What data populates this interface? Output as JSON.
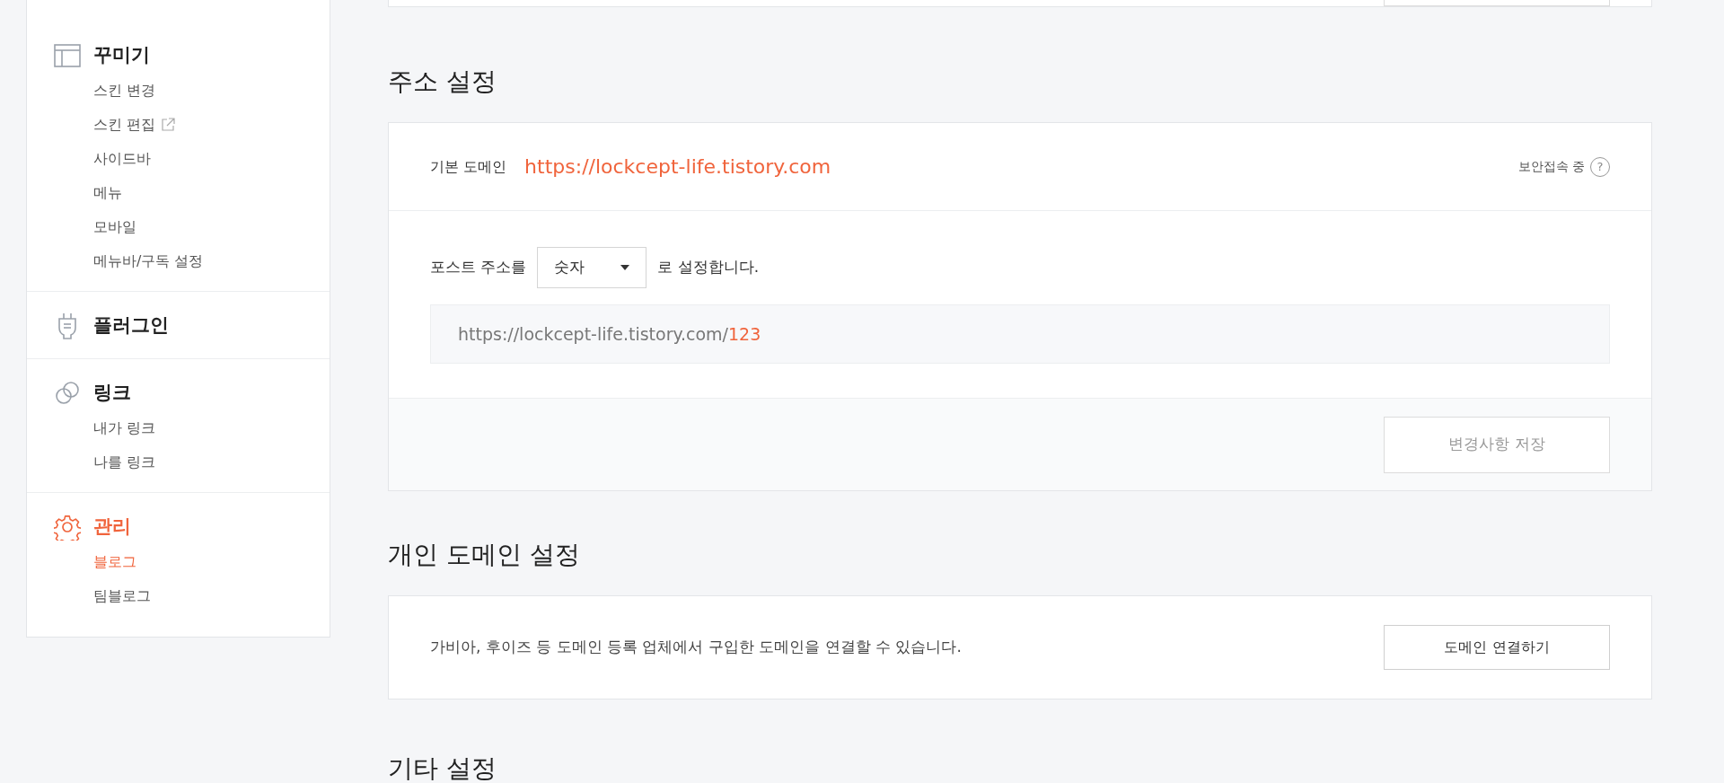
{
  "sidebar": {
    "groups": [
      {
        "kind": "layout",
        "title": "꾸미기",
        "selected": false,
        "items": [
          {
            "label": "스킨 변경",
            "selected": false,
            "external": false
          },
          {
            "label": "스킨 편집",
            "selected": false,
            "external": true
          },
          {
            "label": "사이드바",
            "selected": false,
            "external": false
          },
          {
            "label": "메뉴",
            "selected": false,
            "external": false
          },
          {
            "label": "모바일",
            "selected": false,
            "external": false
          },
          {
            "label": "메뉴바/구독 설정",
            "selected": false,
            "external": false
          }
        ]
      },
      {
        "kind": "plug",
        "title": "플러그인",
        "selected": false
      },
      {
        "kind": "link",
        "title": "링크",
        "selected": false,
        "items": [
          {
            "label": "내가 링크",
            "selected": false,
            "external": false
          },
          {
            "label": "나를 링크",
            "selected": false,
            "external": false
          }
        ]
      },
      {
        "kind": "gear",
        "title": "관리",
        "selected": true,
        "items": [
          {
            "label": "블로그",
            "selected": true,
            "external": false
          },
          {
            "label": "팀블로그",
            "selected": false,
            "external": false
          }
        ]
      }
    ]
  },
  "address_settings": {
    "heading": "주소 설정",
    "default_domain_label": "기본 도메인",
    "default_domain_url": "https://lockcept-life.tistory.com",
    "security_label": "보안접속 중",
    "help_icon_text": "?",
    "post_address_prefix": "포스트 주소를",
    "post_address_select": "숫자",
    "post_address_suffix": "로 설정합니다.",
    "preview_base": "https://lockcept-life.tistory.com/",
    "preview_id": "123",
    "save_button": "변경사항 저장"
  },
  "custom_domain": {
    "heading": "개인 도메인 설정",
    "description": "가비아, 후이즈 등 도메인 등록 업체에서 구입한 도메인을 연결할 수 있습니다.",
    "button": "도메인 연결하기"
  },
  "other_settings": {
    "heading": "기타 설정"
  }
}
